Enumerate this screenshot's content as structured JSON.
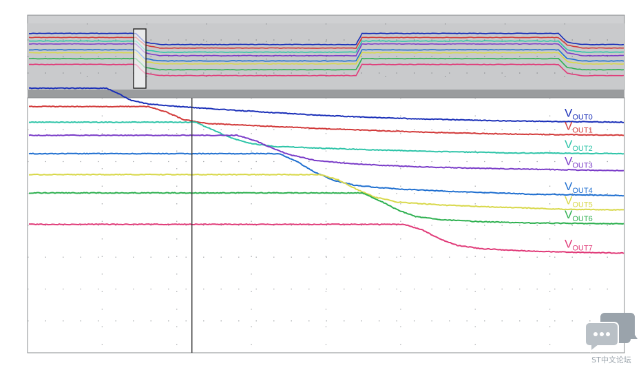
{
  "chart_data": {
    "type": "line",
    "title": "",
    "xlabel": "",
    "ylabel": "",
    "grid": true,
    "overview": {
      "xlim": [
        0,
        100
      ],
      "ylim": [
        0,
        100
      ]
    },
    "detail": {
      "xlim": [
        0,
        100
      ],
      "ylim": [
        0,
        100
      ],
      "cursor_x": 27.4
    },
    "series": [
      {
        "name": "VOUT0",
        "label_main": "V",
        "label_sub": "OUT0",
        "color": "#1a2fb8",
        "overview": {
          "x": [
            0,
            18,
            19.5,
            22,
            55,
            56,
            89,
            90.5,
            93,
            100
          ],
          "y": [
            90,
            90,
            75,
            71,
            71,
            90,
            90,
            75,
            71,
            71
          ]
        },
        "detail": {
          "x": [
            0,
            13,
            15,
            17,
            20,
            25,
            35,
            50,
            65,
            80,
            100
          ],
          "y": [
            90,
            90,
            88,
            85.5,
            84,
            83,
            81.5,
            79.5,
            78.3,
            77.5,
            77
          ]
        }
      },
      {
        "name": "VOUT1",
        "label_main": "V",
        "label_sub": "OUT1",
        "color": "#d23a3a",
        "overview": {
          "x": [
            0,
            18,
            19.5,
            22,
            55,
            56,
            89,
            90.5,
            93,
            100
          ],
          "y": [
            83,
            83,
            70,
            65,
            65,
            83,
            83,
            70,
            65,
            65
          ]
        },
        "detail": {
          "x": [
            0,
            20,
            23,
            26,
            30,
            35,
            50,
            65,
            80,
            100
          ],
          "y": [
            83,
            83,
            81,
            78,
            76.5,
            76,
            74.5,
            73.3,
            72.5,
            72
          ]
        }
      },
      {
        "name": "VOUT2",
        "label_main": "V",
        "label_sub": "OUT2",
        "color": "#2ec4a8",
        "overview": {
          "x": [
            0,
            18,
            19.5,
            22,
            55,
            56,
            89,
            90.5,
            93,
            100
          ],
          "y": [
            77,
            77,
            62,
            58,
            58,
            77,
            77,
            62,
            58,
            58
          ]
        },
        "detail": {
          "x": [
            0,
            28,
            31,
            34,
            37,
            41,
            50,
            65,
            80,
            100
          ],
          "y": [
            77,
            77,
            74,
            71,
            69,
            67.8,
            67,
            66,
            65.3,
            65
          ]
        }
      },
      {
        "name": "VOUT3",
        "label_main": "V",
        "label_sub": "OUT3",
        "color": "#7a3cc8",
        "overview": {
          "x": [
            0,
            18,
            19.5,
            22,
            55,
            56,
            89,
            90.5,
            93,
            100
          ],
          "y": [
            72,
            72,
            57,
            52,
            52,
            72,
            72,
            57,
            52,
            52
          ]
        },
        "detail": {
          "x": [
            0,
            35,
            38,
            41,
            44,
            48,
            55,
            65,
            80,
            100
          ],
          "y": [
            72,
            72,
            70,
            67,
            64.5,
            62.5,
            61,
            60,
            59.2,
            58.5
          ]
        }
      },
      {
        "name": "VOUT4",
        "label_main": "V",
        "label_sub": "OUT4",
        "color": "#1f6fd0",
        "overview": {
          "x": [
            0,
            18,
            19.5,
            22,
            55,
            56,
            89,
            90.5,
            93,
            100
          ],
          "y": [
            62,
            62,
            47,
            43,
            43,
            62,
            62,
            47,
            43,
            43
          ]
        },
        "detail": {
          "x": [
            0,
            42,
            45,
            48,
            51,
            55,
            62,
            72,
            85,
            100
          ],
          "y": [
            65,
            65,
            62,
            58,
            55,
            52.8,
            51.5,
            50.5,
            49.5,
            49
          ]
        }
      },
      {
        "name": "VOUT5",
        "label_main": "V",
        "label_sub": "OUT5",
        "color": "#d8d84a",
        "overview": {
          "x": [
            0,
            18,
            19.5,
            22,
            55,
            56,
            89,
            90.5,
            93,
            100
          ],
          "y": [
            57,
            57,
            42,
            38,
            38,
            57,
            57,
            42,
            38,
            38
          ]
        },
        "detail": {
          "x": [
            0,
            49,
            52,
            55,
            58,
            62,
            70,
            80,
            90,
            100
          ],
          "y": [
            57,
            57,
            55,
            51.5,
            48.5,
            46.5,
            45.3,
            44.5,
            43.8,
            43.5
          ]
        }
      },
      {
        "name": "VOUT6",
        "label_main": "V",
        "label_sub": "OUT6",
        "color": "#2eb050",
        "overview": {
          "x": [
            0,
            18,
            19.5,
            22,
            55,
            56,
            89,
            90.5,
            93,
            100
          ],
          "y": [
            47,
            47,
            32,
            28,
            28,
            47,
            47,
            32,
            28,
            28
          ]
        },
        "detail": {
          "x": [
            0,
            56,
            59,
            62,
            65,
            69,
            76,
            85,
            100
          ],
          "y": [
            50,
            50,
            47,
            43.5,
            41,
            39.8,
            39,
            38.5,
            38.2
          ]
        }
      },
      {
        "name": "VOUT7",
        "label_main": "V",
        "label_sub": "OUT7",
        "color": "#e03a78",
        "overview": {
          "x": [
            0,
            18,
            19.5,
            22,
            55,
            56,
            89,
            90.5,
            93,
            100
          ],
          "y": [
            37,
            37,
            22,
            18,
            18,
            37,
            37,
            22,
            18,
            18
          ]
        },
        "detail": {
          "x": [
            0,
            63,
            66,
            69,
            72,
            76,
            84,
            92,
            100
          ],
          "y": [
            38,
            38,
            36,
            32.5,
            30,
            28.7,
            27.8,
            27.3,
            27
          ]
        }
      }
    ]
  },
  "watermark": {
    "text": "ST中文论坛"
  }
}
